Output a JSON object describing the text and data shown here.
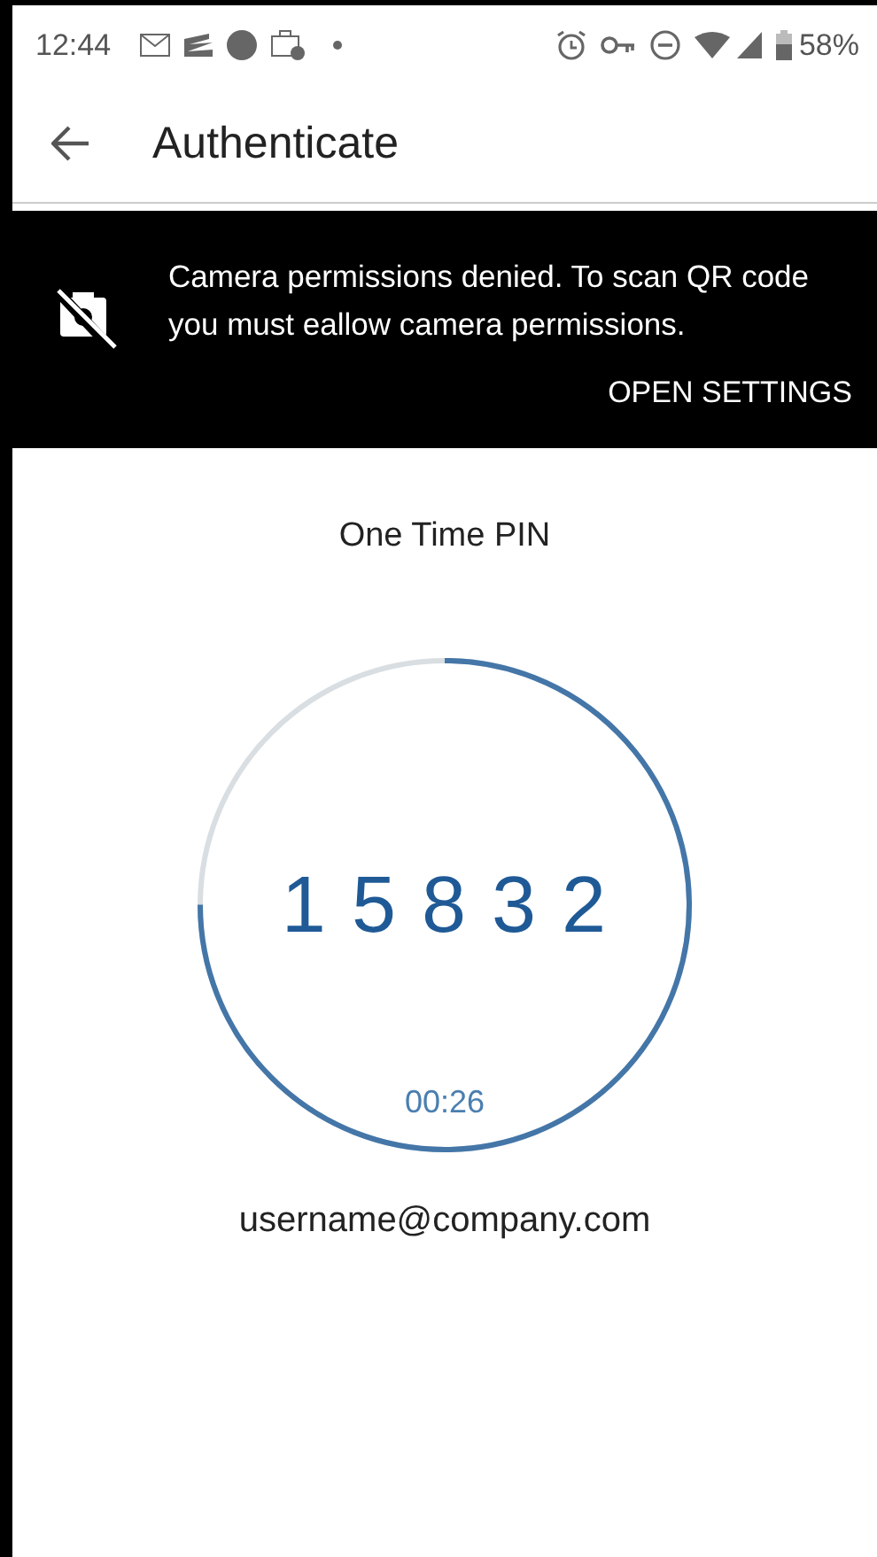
{
  "status_bar": {
    "time": "12:44",
    "battery": "58%"
  },
  "app_bar": {
    "title": "Authenticate"
  },
  "banner": {
    "message": "Camera permissions denied. To scan QR code you must eallow camera permissions.",
    "action": "OPEN SETTINGS"
  },
  "otp": {
    "title": "One Time PIN",
    "code": "1 5 8 3 2",
    "timer": "00:26",
    "level": 0.75
  },
  "account": "username@company.com"
}
